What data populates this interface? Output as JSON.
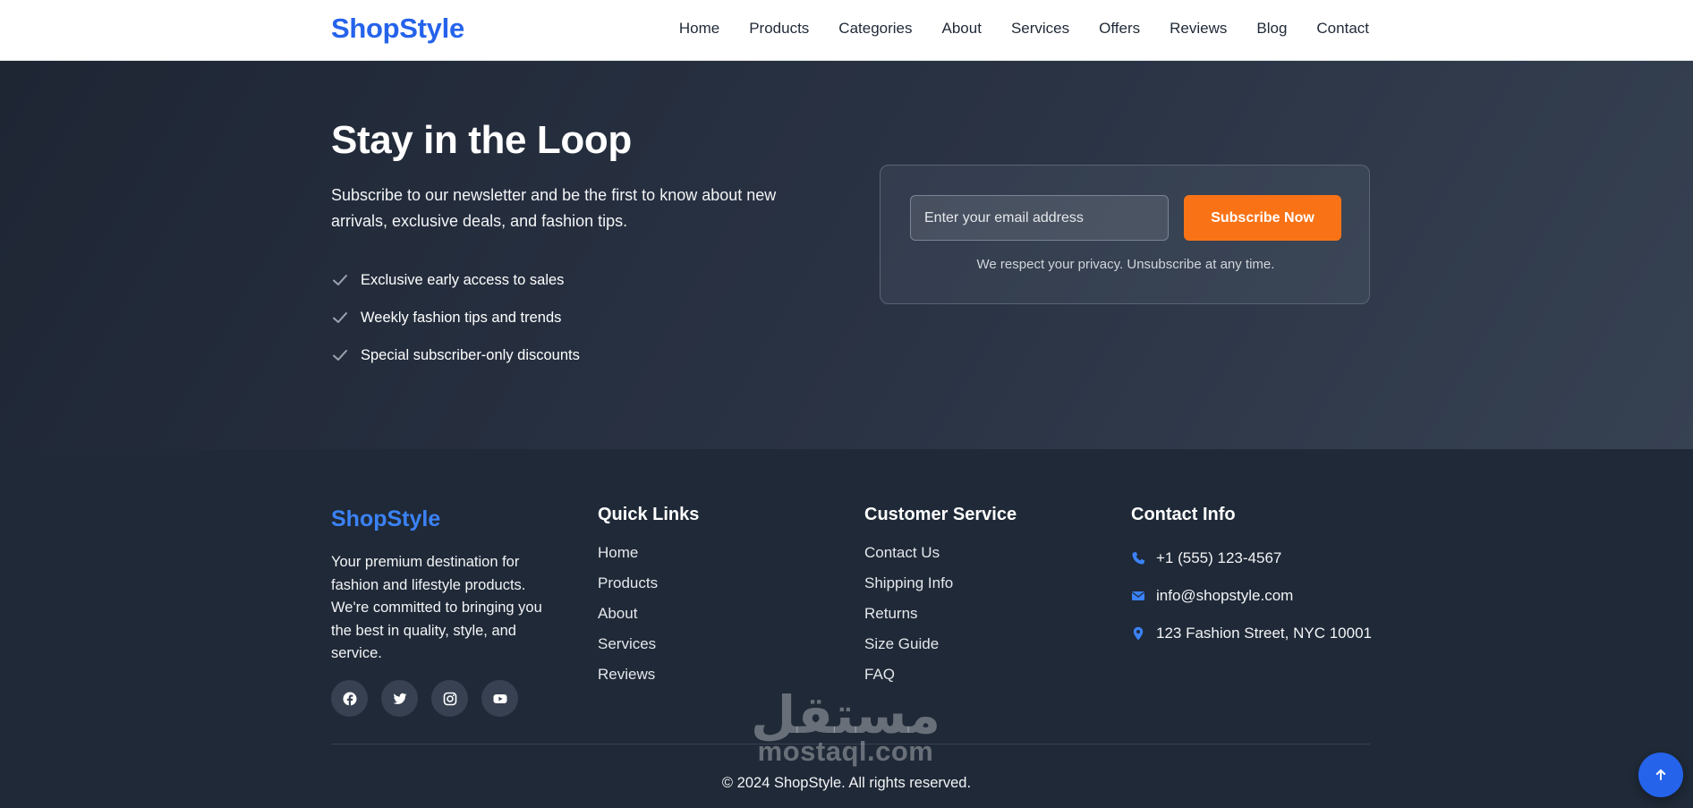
{
  "header": {
    "brand": "ShopStyle",
    "nav": [
      "Home",
      "Products",
      "Categories",
      "About",
      "Services",
      "Offers",
      "Reviews",
      "Blog",
      "Contact"
    ]
  },
  "newsletter": {
    "title": "Stay in the Loop",
    "description": "Subscribe to our newsletter and be the first to know about new arrivals, exclusive deals, and fashion tips.",
    "benefits": [
      "Exclusive early access to sales",
      "Weekly fashion tips and trends",
      "Special subscriber-only discounts"
    ],
    "email_placeholder": "Enter your email address",
    "email_value": "",
    "subscribe_label": "Subscribe Now",
    "privacy_note": "We respect your privacy. Unsubscribe at any time."
  },
  "footer": {
    "brand": "ShopStyle",
    "about": "Your premium destination for fashion and lifestyle products. We're committed to bringing you the best in quality, style, and service.",
    "socials": [
      "facebook-icon",
      "twitter-icon",
      "instagram-icon",
      "youtube-icon"
    ],
    "quick_links": {
      "title": "Quick Links",
      "items": [
        "Home",
        "Products",
        "About",
        "Services",
        "Reviews"
      ]
    },
    "customer_service": {
      "title": "Customer Service",
      "items": [
        "Contact Us",
        "Shipping Info",
        "Returns",
        "Size Guide",
        "FAQ"
      ]
    },
    "contact_info": {
      "title": "Contact Info",
      "phone": "+1 (555) 123-4567",
      "email": "info@shopstyle.com",
      "address": "123 Fashion Street, NYC 10001"
    },
    "copyright": "© 2024 ShopStyle. All rights reserved."
  },
  "watermark": {
    "arabic": "مستقل",
    "latin": "mostaql.com"
  },
  "colors": {
    "brand_blue": "#2563eb",
    "accent_orange": "#f97316",
    "dark_bg": "#1f2937"
  }
}
